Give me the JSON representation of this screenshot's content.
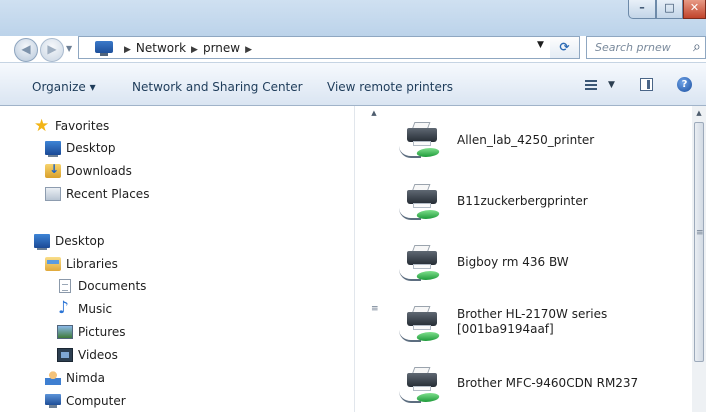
{
  "window": {
    "controls": {
      "minimize": "–",
      "maximize": "□",
      "close": "✕"
    }
  },
  "address_bar": {
    "back_glyph": "◀",
    "forward_glyph": "▶",
    "path": [
      "Network",
      "prnew"
    ],
    "separator": "▶",
    "dropdown_glyph": "▼",
    "refresh_glyph": "⟳",
    "search_placeholder": "Search prnew",
    "search_icon": "magnifier-icon"
  },
  "command_bar": {
    "organize": "Organize ▾",
    "network_sharing": "Network and Sharing Center",
    "view_remote": "View remote printers",
    "views_dropdown": "▼",
    "help": "?"
  },
  "nav_pane": {
    "items": [
      {
        "label": "Favorites",
        "icon": "star-icon"
      },
      {
        "label": "Desktop",
        "icon": "desktop-icon"
      },
      {
        "label": "Downloads",
        "icon": "downloads-folder-icon"
      },
      {
        "label": "Recent Places",
        "icon": "recent-places-icon"
      },
      {
        "label": "Desktop",
        "icon": "desktop-icon"
      },
      {
        "label": "Libraries",
        "icon": "libraries-icon"
      },
      {
        "label": "Documents",
        "icon": "document-icon"
      },
      {
        "label": "Music",
        "icon": "music-note-icon"
      },
      {
        "label": "Pictures",
        "icon": "pictures-icon"
      },
      {
        "label": "Videos",
        "icon": "videos-icon"
      },
      {
        "label": "Nimda",
        "icon": "user-folder-icon"
      },
      {
        "label": "Computer",
        "icon": "computer-icon"
      }
    ]
  },
  "printers": [
    {
      "name": "Allen_lab_4250_printer",
      "name2": ""
    },
    {
      "name": "B11zuckerbergprinter",
      "name2": ""
    },
    {
      "name": "Bigboy rm 436 BW",
      "name2": ""
    },
    {
      "name": "Brother HL-2170W series",
      "name2": "[001ba9194aaf]"
    },
    {
      "name": "Brother MFC-9460CDN RM237",
      "name2": ""
    }
  ],
  "scrollbar": {
    "up": "▲",
    "down": "▼",
    "grip": "≡"
  },
  "colors": {
    "titlebar": "#c4d8ee",
    "close_button": "#c1442c",
    "command_bar_text": "#1e3c5a"
  }
}
